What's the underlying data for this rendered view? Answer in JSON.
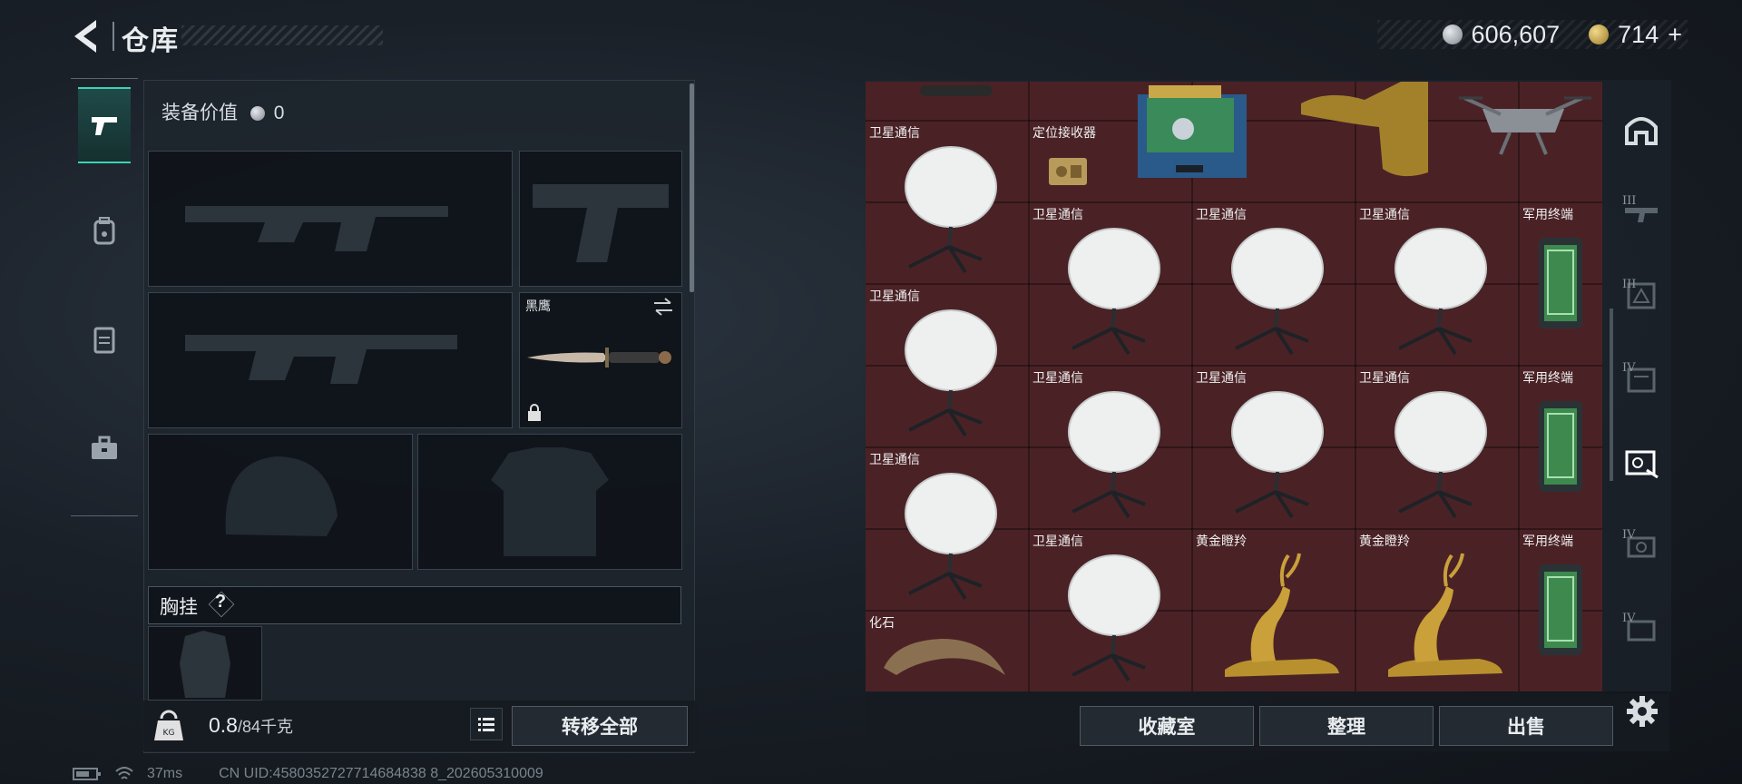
{
  "header": {
    "title": "仓库"
  },
  "currency": {
    "silver": "606,607",
    "gold": "714",
    "gold_plus": "+"
  },
  "equipment": {
    "value_label": "装备价值",
    "value": "0",
    "knife_name": "黑鹰",
    "chest_label": "胸挂",
    "chest_help": "?"
  },
  "weight": {
    "current": "0.8",
    "max": "/84千克"
  },
  "buttons": {
    "transfer_all": "转移全部",
    "collection": "收藏室",
    "organize": "整理",
    "sell": "出售"
  },
  "status": {
    "ping": "37ms",
    "uid": "CN UID:4580352727714684838 8_202605310009"
  },
  "items": {
    "satcom": "卫星通信",
    "receiver": "定位接收器",
    "military_terminal": "军用终端",
    "golden_deer": "黄金瞪羚",
    "fossil": "化石"
  },
  "category_tabs": [
    "III",
    "III",
    "IV",
    "",
    "IV",
    "IV"
  ],
  "colors": {
    "accent": "#3fd1b8",
    "grid_bg": "#4a2226"
  }
}
